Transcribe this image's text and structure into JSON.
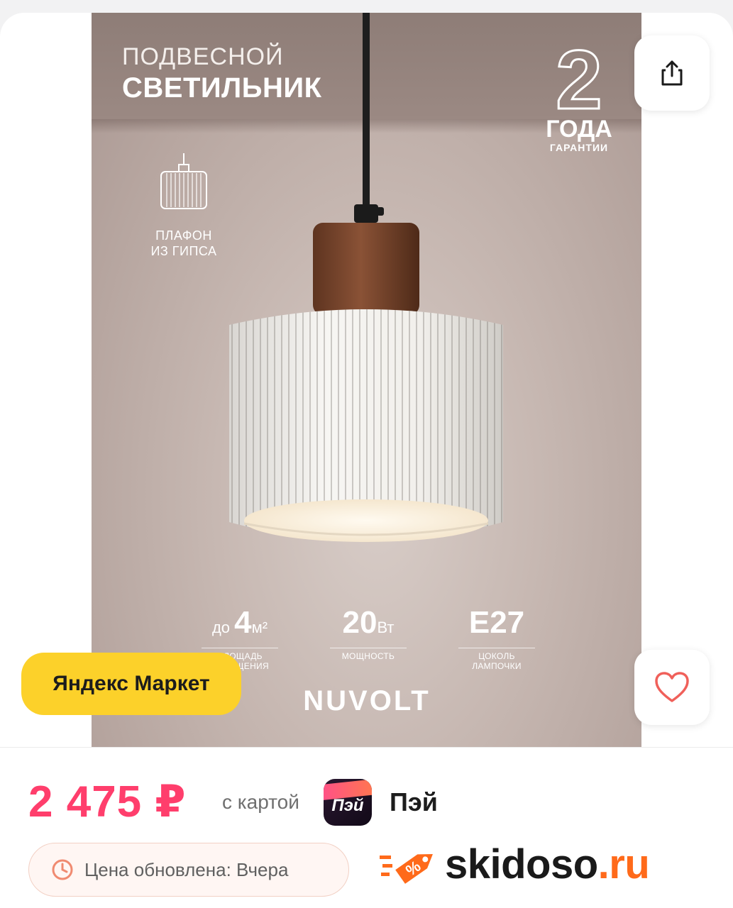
{
  "product_image": {
    "title_line1": "ПОДВЕСНОЙ",
    "title_line2": "СВЕТИЛЬНИК",
    "warranty": {
      "number": "2",
      "word": "ГОДА",
      "caption": "ГАРАНТИИ"
    },
    "shade_badge": {
      "line1": "ПЛАФОН",
      "line2": "ИЗ ГИПСА",
      "icon": "lamp-shade-icon"
    },
    "specs": [
      {
        "prefix": "до ",
        "value": "4",
        "unit": "м²",
        "caption1": "ПЛОЩАДЬ",
        "caption2": "ОСВЕЩЕНИЯ"
      },
      {
        "prefix": "",
        "value": "20",
        "unit": "Вт",
        "caption1": "МОЩНОСТЬ",
        "caption2": ""
      },
      {
        "prefix": "",
        "value": "E27",
        "unit": "",
        "caption1": "ЦОКОЛЬ",
        "caption2": "ЛАМПОЧКИ"
      }
    ],
    "brand": "NUVOLT"
  },
  "actions": {
    "share_icon": "share-icon",
    "favorite_icon": "heart-icon"
  },
  "store": {
    "label": "Яндекс Маркет",
    "color": "#fcd12a"
  },
  "pricing": {
    "price": "2 475 ₽",
    "price_color": "#ff3e6c",
    "card_text": "с картой",
    "pay_icon_text": "Пэй",
    "pay_name": "Пэй",
    "updated_text": "Цена обновлена: Вчера",
    "updated_icon": "clock-icon"
  },
  "watermark": {
    "name": "skidoso",
    "tld": ".ru",
    "icon": "discount-tag-icon",
    "accent": "#ff6a1a"
  }
}
